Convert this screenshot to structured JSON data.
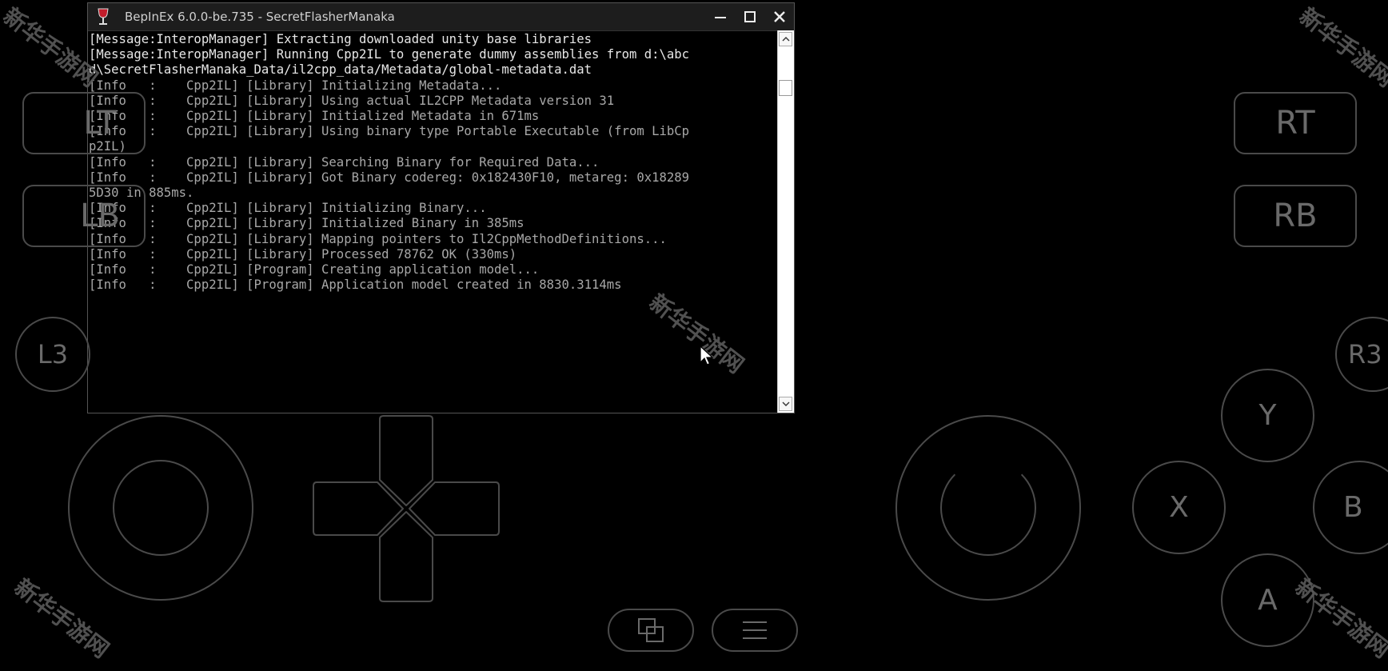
{
  "window": {
    "title": "BepInEx 6.0.0-be.735 - SecretFlasherManaka",
    "minimize_icon": "minimize-icon",
    "maximize_icon": "maximize-icon",
    "close_icon": "close-icon"
  },
  "console": {
    "lines": [
      {
        "type": "msg",
        "text": "[Message:InteropManager] Extracting downloaded unity base libraries"
      },
      {
        "type": "msg",
        "text": "[Message:InteropManager] Running Cpp2IL to generate dummy assemblies from d:\\abc"
      },
      {
        "type": "msg",
        "text": "d\\SecretFlasherManaka_Data/il2cpp_data/Metadata/global-metadata.dat"
      },
      {
        "type": "info",
        "text": "[Info   :    Cpp2IL] [Library] Initializing Metadata..."
      },
      {
        "type": "info",
        "text": "[Info   :    Cpp2IL] [Library] Using actual IL2CPP Metadata version 31"
      },
      {
        "type": "info",
        "text": "[Info   :    Cpp2IL] [Library] Initialized Metadata in 671ms"
      },
      {
        "type": "info",
        "text": "[Info   :    Cpp2IL] [Library] Using binary type Portable Executable (from LibCp"
      },
      {
        "type": "info",
        "text": "p2IL)"
      },
      {
        "type": "info",
        "text": "[Info   :    Cpp2IL] [Library] Searching Binary for Required Data..."
      },
      {
        "type": "info",
        "text": "[Info   :    Cpp2IL] [Library] Got Binary codereg: 0x182430F10, metareg: 0x18289"
      },
      {
        "type": "info",
        "text": "5D30 in 885ms."
      },
      {
        "type": "info",
        "text": "[Info   :    Cpp2IL] [Library] Initializing Binary..."
      },
      {
        "type": "info",
        "text": "[Info   :    Cpp2IL] [Library] Initialized Binary in 385ms"
      },
      {
        "type": "info",
        "text": "[Info   :    Cpp2IL] [Library] Mapping pointers to Il2CppMethodDefinitions..."
      },
      {
        "type": "info",
        "text": "[Info   :    Cpp2IL] [Library] Processed 78762 OK (330ms)"
      },
      {
        "type": "info",
        "text": "[Info   :    Cpp2IL] [Program] Creating application model..."
      },
      {
        "type": "info",
        "text": "[Info   :    Cpp2IL] [Program] Application model created in 8830.3114ms"
      }
    ]
  },
  "gamepad": {
    "lt": "LT",
    "lb": "LB",
    "rt": "RT",
    "rb": "RB",
    "l3": "L3",
    "r3": "R3",
    "y": "Y",
    "x": "X",
    "b": "B",
    "a": "A"
  },
  "watermark": "新华手游网"
}
